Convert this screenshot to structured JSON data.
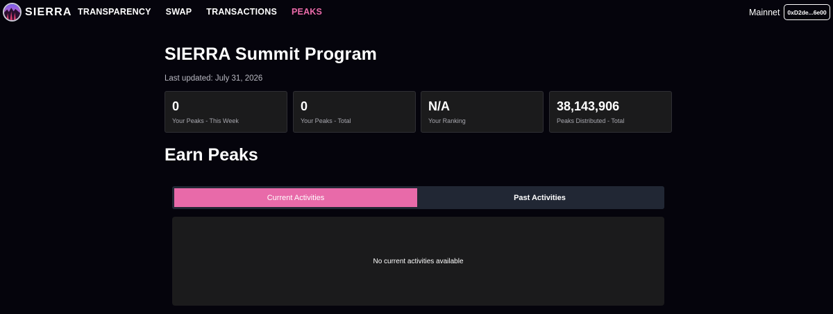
{
  "brand": {
    "name": "SIERRA"
  },
  "nav": {
    "links": [
      {
        "label": "TRANSPARENCY",
        "active": false
      },
      {
        "label": "SWAP",
        "active": false
      },
      {
        "label": "TRANSACTIONS",
        "active": false
      },
      {
        "label": "PEAKS",
        "active": true
      }
    ],
    "network": "Mainnet",
    "wallet": "0xD2de...6e00"
  },
  "page": {
    "title": "SIERRA Summit Program",
    "last_updated": "Last updated: July 31, 2026"
  },
  "stats": [
    {
      "value": "0",
      "label": "Your Peaks - This Week"
    },
    {
      "value": "0",
      "label": "Your Peaks - Total"
    },
    {
      "value": "N/A",
      "label": "Your Ranking"
    },
    {
      "value": "38,143,906",
      "label": "Peaks Distributed - Total"
    }
  ],
  "earn": {
    "title": "Earn Peaks",
    "tabs": [
      {
        "label": "Current Activities",
        "active": true
      },
      {
        "label": "Past Activities",
        "active": false
      }
    ],
    "empty_message": "No current activities available"
  },
  "colors": {
    "accent": "#e86aa9",
    "background": "#05040c",
    "card": "#1b1b1c",
    "tab_bar": "#212734"
  }
}
